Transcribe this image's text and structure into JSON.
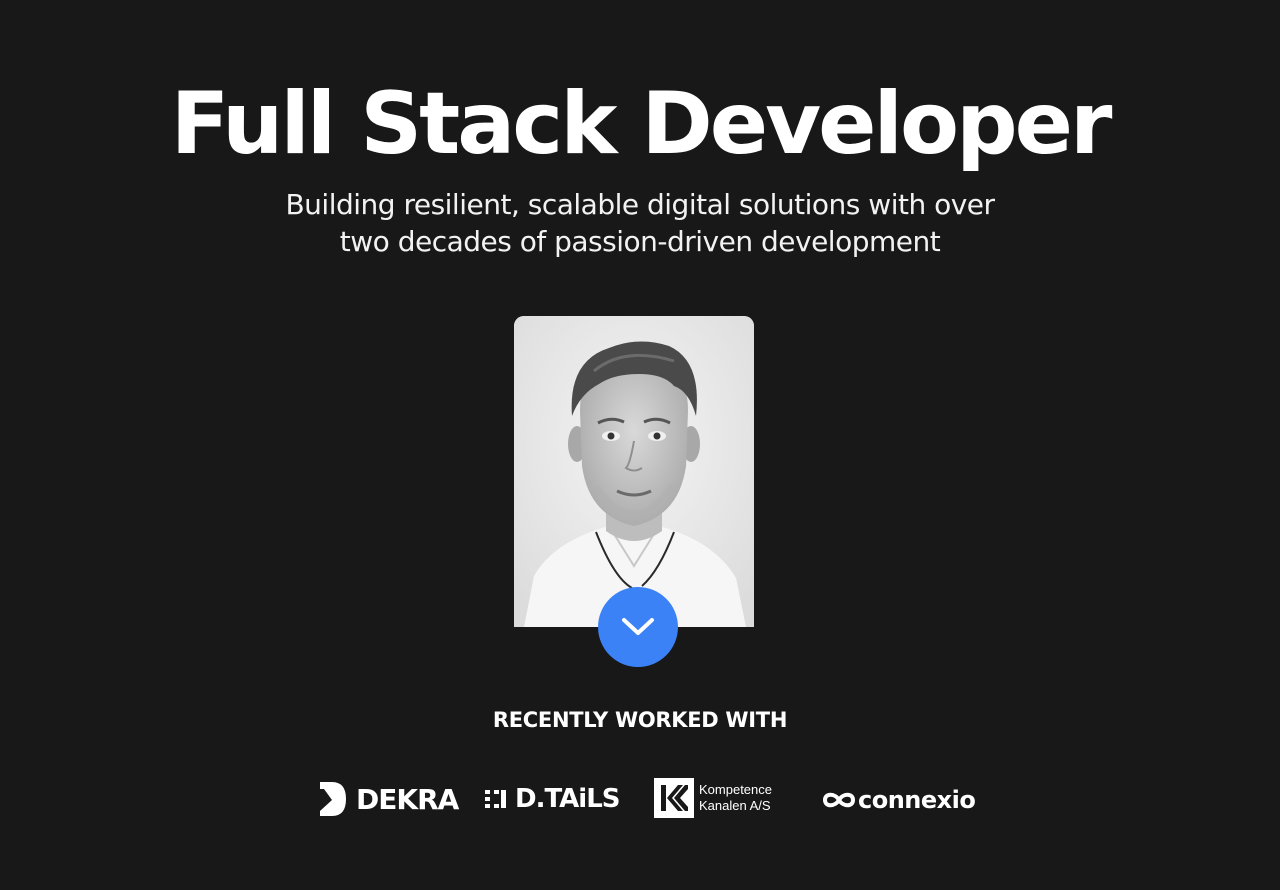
{
  "hero": {
    "title": "Full Stack Developer",
    "subtitle_line1": "Building resilient, scalable digital solutions with over",
    "subtitle_line2": "two decades of passion-driven development"
  },
  "profile": {
    "photo_icon": "portrait-photo"
  },
  "scroll_button": {
    "icon": "chevron-down-icon",
    "color": "#3b82f6"
  },
  "clients": {
    "heading": "RECENTLY WORKED WITH",
    "logos": [
      {
        "name": "DEKRA",
        "icon": "dekra-logo-mark"
      },
      {
        "name": "D.TAiLS",
        "icon": "dtails-logo-mark"
      },
      {
        "name": "Kompetence",
        "name_line2": "Kanalen A/S",
        "icon": "kk-logo-mark"
      },
      {
        "name": "connexio",
        "icon": "infinity-icon"
      }
    ]
  },
  "colors": {
    "background": "#181818",
    "text": "#ffffff",
    "accent": "#3b82f6"
  }
}
